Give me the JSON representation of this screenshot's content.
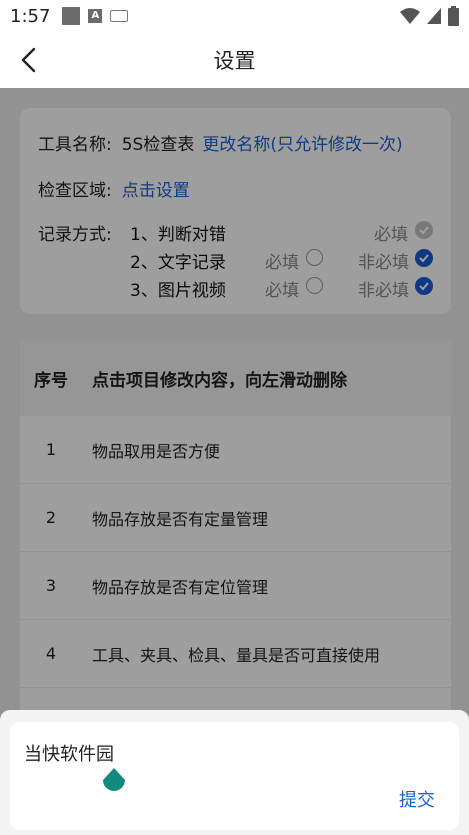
{
  "status_bar": {
    "time": "1:57",
    "a_icon_letter": "A"
  },
  "nav": {
    "title": "设置"
  },
  "card": {
    "tool_name_label": "工具名称:",
    "tool_name_value": "5S检查表",
    "rename_link": "更改名称(只允许修改一次)",
    "area_label": "检查区域:",
    "area_link": "点击设置",
    "record_label": "记录方式:",
    "methods": [
      {
        "name": "1、判断对错",
        "required": "必填"
      },
      {
        "name": "2、文字记录",
        "required": "必填",
        "optional": "非必填",
        "selected": "optional"
      },
      {
        "name": "3、图片视频",
        "required": "必填",
        "optional": "非必填",
        "selected": "optional"
      }
    ]
  },
  "table": {
    "col_index": "序号",
    "col_hint": "点击项目修改内容，向左滑动删除",
    "rows": [
      {
        "index": "1",
        "item": "物品取用是否方便"
      },
      {
        "index": "2",
        "item": "物品存放是否有定量管理"
      },
      {
        "index": "3",
        "item": "物品存放是否有定位管理"
      },
      {
        "index": "4",
        "item": "工具、夹具、检具、量具是否可直接使用"
      }
    ]
  },
  "sheet": {
    "input_value": "当快软件园",
    "submit_label": "提交"
  },
  "colors": {
    "accent": "#1a5bd6",
    "link": "#1f5fcf",
    "cursor": "#138a7e"
  }
}
